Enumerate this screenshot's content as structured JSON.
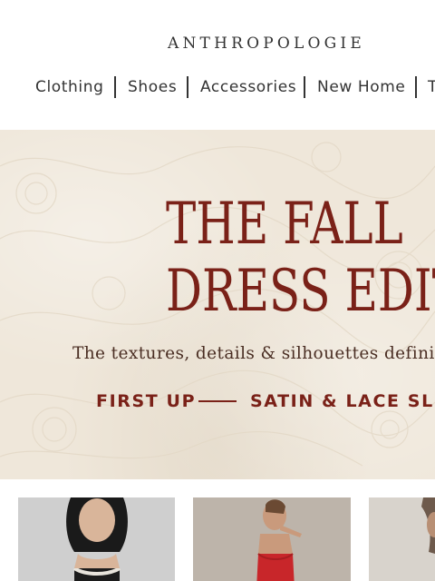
{
  "header": {
    "logo": "ANTHROPOLOGIE",
    "nav": [
      {
        "label": "Clothing"
      },
      {
        "label": "Shoes"
      },
      {
        "label": "Accessories"
      },
      {
        "label": "New Home"
      },
      {
        "label": "T"
      }
    ]
  },
  "hero": {
    "title_line1": "THE FALL",
    "title_line2": "DRESS EDIT",
    "subtitle": "The textures, details & silhouettes defining",
    "cta_label": "FIRST UP",
    "cta_topic": "SATIN & LACE SLIP"
  },
  "colors": {
    "accent": "#7a2118",
    "hero_background": "#efe7da",
    "text": "#333333"
  }
}
